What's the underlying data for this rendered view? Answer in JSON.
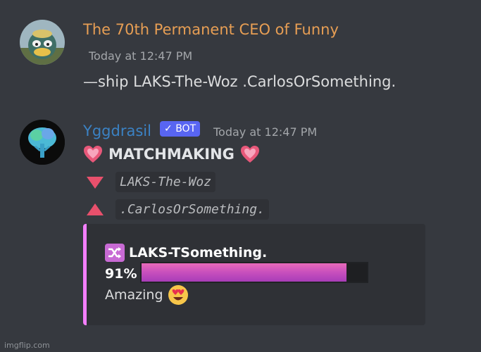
{
  "messages": [
    {
      "author": "The 70th Permanent CEO of Funny",
      "author_color": "#e79e54",
      "timestamp": "Today at 12:47 PM",
      "content": "—ship LAKS-The-Woz .CarlosOrSomething."
    },
    {
      "author": "Yggdrasil",
      "author_color": "#3b82c4",
      "bot_tag": "BOT",
      "timestamp": "Today at 12:47 PM",
      "title": "MATCHMAKING",
      "user_a": "LAKS-The-Woz",
      "user_b": ".CarlosOrSomething.",
      "embed": {
        "ship_name": "LAKS-TSomething.",
        "percent_label": "91%",
        "percent_value": 0.91,
        "verdict": "Amazing",
        "accent": "#f47fff"
      }
    }
  ],
  "watermark": "imgflip.com"
}
